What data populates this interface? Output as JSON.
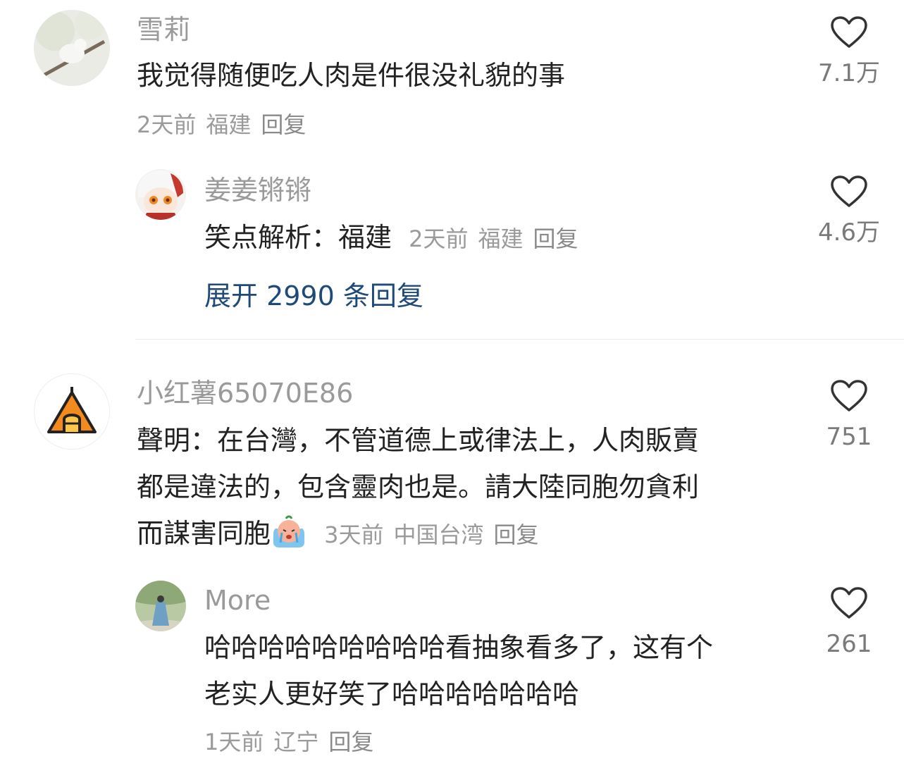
{
  "comments": [
    {
      "username": "雪莉",
      "text_lines": [
        "我觉得随便吃人肉是件很没礼貌的事"
      ],
      "time": "2天前",
      "location": "福建",
      "reply_label": "回复",
      "likes": "7.1万",
      "replies": [
        {
          "username": "姜姜锵锵",
          "text": "笑点解析：福建",
          "time": "2天前",
          "location": "福建",
          "reply_label": "回复",
          "likes": "4.6万"
        }
      ],
      "expand_label": "展开 2990 条回复"
    },
    {
      "username": "小红薯65070E86",
      "text_lines": [
        "聲明：在台灣，不管道德上或律法上，人肉販賣",
        "都是違法的，包含靈肉也是。請大陸同胞勿貪利",
        "而謀害同胞"
      ],
      "time": "3天前",
      "location": "中国台湾",
      "reply_label": "回复",
      "likes": "751",
      "replies": [
        {
          "username": "More",
          "text_lines": [
            "哈哈哈哈哈哈哈哈哈看抽象看多了，这有个",
            "老实人更好笑了哈哈哈哈哈哈哈"
          ],
          "time": "1天前",
          "location": "辽宁",
          "reply_label": "回复",
          "likes": "261"
        }
      ]
    }
  ],
  "icons": {
    "like": "heart-outline-icon",
    "crying_emoji": "crying-face-emoji-icon"
  },
  "colors": {
    "text": "#222222",
    "secondary": "#9a9a9a",
    "link": "#1e4a7a",
    "divider": "#e8e8e8"
  }
}
